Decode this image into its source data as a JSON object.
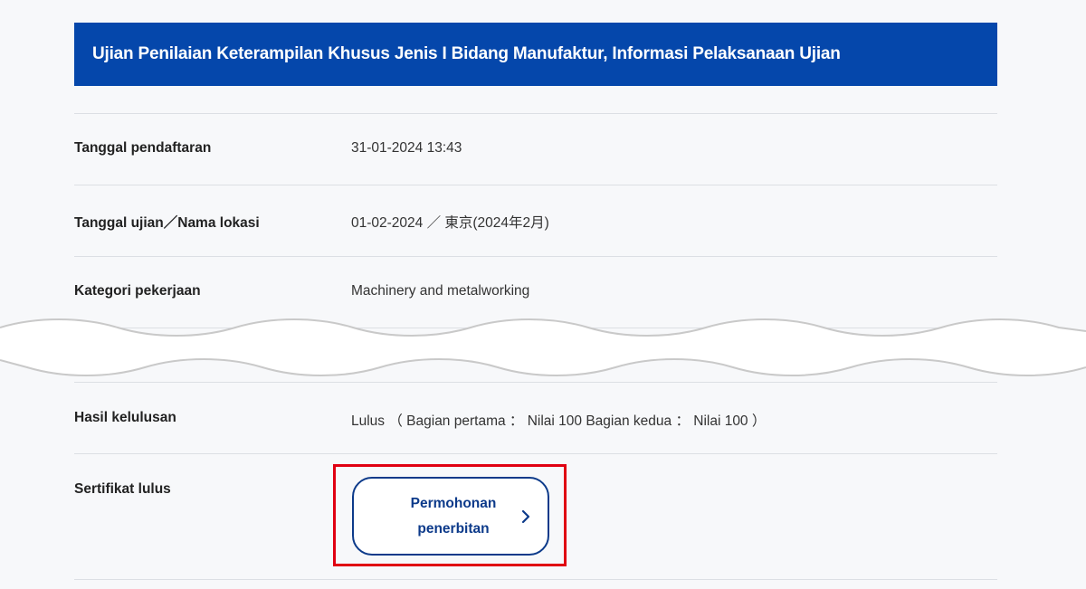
{
  "header": {
    "title": "Ujian Penilaian Keterampilan Khusus Jenis I Bidang Manufaktur, Informasi Pelaksanaan Ujian"
  },
  "rows": [
    {
      "label": "Tanggal pendaftaran",
      "value": "31-01-2024 13:43"
    },
    {
      "label": "Tanggal ujian／Nama lokasi",
      "value": "01-02-2024 ／ 東京(2024年2月)"
    },
    {
      "label": "Kategori pekerjaan",
      "value": "Machinery and metalworking"
    },
    {
      "label": "Hasil kelulusan",
      "value": "Lulus （ Bagian pertama ： Nilai 100 Bagian kedua ： Nilai 100 ）"
    },
    {
      "label": "Sertifikat lulus"
    }
  ],
  "certificate": {
    "button_label": "Permohonan penerbitan",
    "button_icon": "chevron-right-icon"
  },
  "colors": {
    "header_bg": "#0547ab",
    "button_border": "#0c3a8a",
    "highlight": "#e00012"
  }
}
